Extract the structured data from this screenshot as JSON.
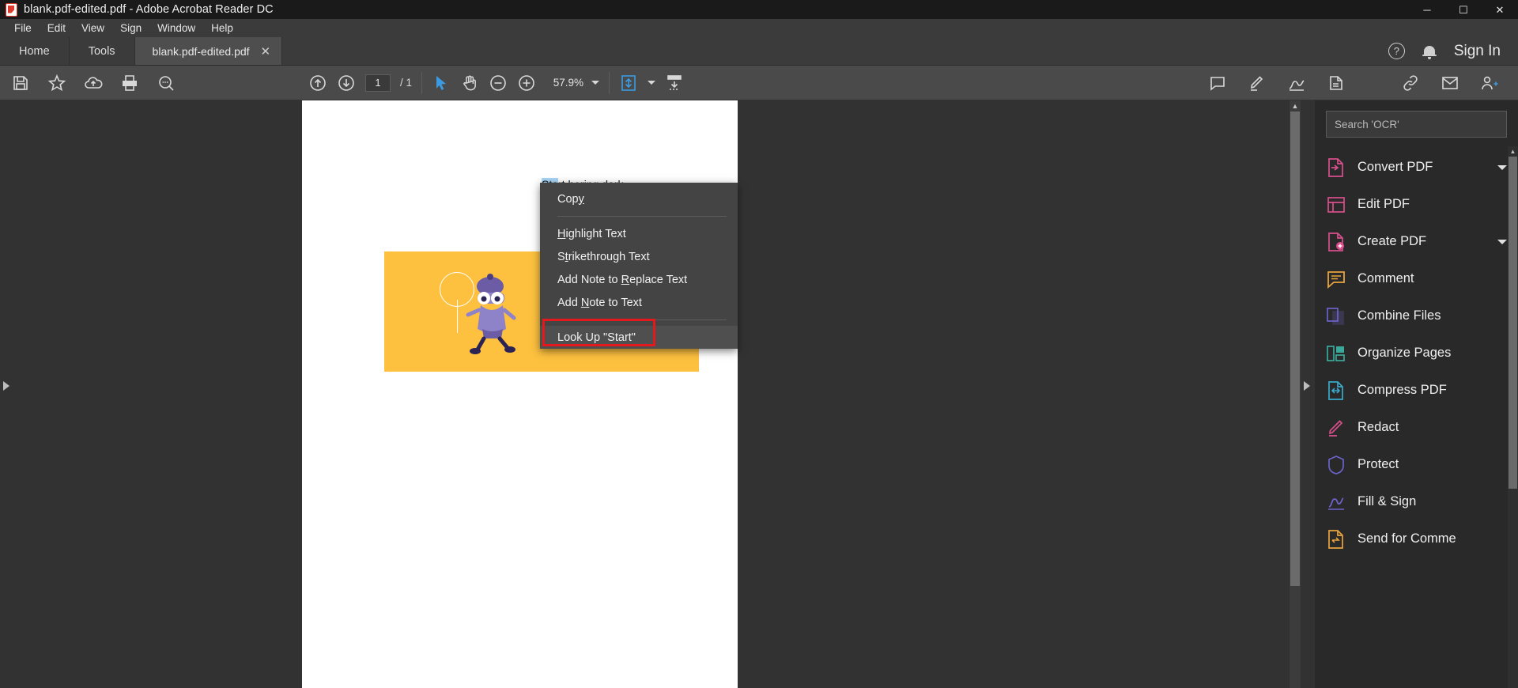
{
  "window": {
    "title": "blank.pdf-edited.pdf - Adobe Acrobat Reader DC",
    "app_icon": "acrobat-icon",
    "minimize": "─",
    "maximize": "☐",
    "close": "✕"
  },
  "menubar": {
    "items": [
      {
        "label": "File"
      },
      {
        "label": "Edit"
      },
      {
        "label": "View"
      },
      {
        "label": "Sign"
      },
      {
        "label": "Window"
      },
      {
        "label": "Help"
      }
    ]
  },
  "tabstrip": {
    "home": "Home",
    "tools": "Tools",
    "document_tab": "blank.pdf-edited.pdf",
    "document_tab_close": "✕",
    "help_icon": "?",
    "bell_icon": "notification-bell-icon",
    "sign_in": "Sign In"
  },
  "toolbar": {
    "left_icons": [
      {
        "name": "save-icon"
      },
      {
        "name": "star-icon"
      },
      {
        "name": "upload-cloud-icon"
      },
      {
        "name": "print-icon"
      },
      {
        "name": "find-icon"
      }
    ],
    "page_up_icon": "page-up-icon",
    "page_down_icon": "page-down-icon",
    "page_number": "1",
    "page_total": "/ 1",
    "select_tool_icon": "select-cursor-icon",
    "hand_tool_icon": "hand-tool-icon",
    "zoom_out_icon": "zoom-out-icon",
    "zoom_in_icon": "zoom-in-icon",
    "zoom_value": "57.9%",
    "fit_page_icon": "fit-page-icon",
    "scroll_mode_icon": "page-display-icon",
    "right_icons": [
      {
        "name": "comment-icon"
      },
      {
        "name": "highlighter-icon"
      },
      {
        "name": "draw-icon"
      },
      {
        "name": "stamp-icon"
      }
    ],
    "far_right_icons": [
      {
        "name": "attach-link-icon"
      },
      {
        "name": "email-icon"
      },
      {
        "name": "add-person-icon"
      }
    ]
  },
  "viewer": {
    "page_text_selected": "Sta",
    "page_text_rest": "rt hering dark",
    "scroll_up_arrow": "▲",
    "scroll_down_arrow": "▼",
    "left_rail_arrow": "left-panel-expand-arrow",
    "right_rail_arrow": "right-panel-expand-arrow",
    "image_alt": "yellow-illustration-card"
  },
  "context_menu": {
    "items": [
      {
        "label": "Copy",
        "accel": "y",
        "highlighted": false
      },
      {
        "separator": true
      },
      {
        "label": "Highlight Text",
        "accel": "H",
        "highlighted": false
      },
      {
        "label": "Strikethrough Text",
        "accel": "t",
        "highlighted": false
      },
      {
        "label": "Add Note to Replace Text",
        "accel": "R",
        "highlighted": false
      },
      {
        "label": "Add Note to Text",
        "accel": "N",
        "highlighted": false
      },
      {
        "separator": true
      },
      {
        "label": "Look Up \"Start\"",
        "accel": "",
        "highlighted": true
      }
    ],
    "highlight_color": "#e3191e"
  },
  "tools_panel": {
    "search_placeholder": "Search 'OCR'",
    "items": [
      {
        "label": "Convert PDF",
        "icon": "convert-pdf-icon",
        "chevron": true
      },
      {
        "label": "Edit PDF",
        "icon": "edit-pdf-icon",
        "chevron": false
      },
      {
        "label": "Create PDF",
        "icon": "create-pdf-icon",
        "chevron": true
      },
      {
        "label": "Comment",
        "icon": "comment-icon",
        "chevron": false
      },
      {
        "label": "Combine Files",
        "icon": "combine-files-icon",
        "chevron": false
      },
      {
        "label": "Organize Pages",
        "icon": "organize-pages-icon",
        "chevron": false
      },
      {
        "label": "Compress PDF",
        "icon": "compress-pdf-icon",
        "chevron": false
      },
      {
        "label": "Redact",
        "icon": "redact-icon",
        "chevron": false
      },
      {
        "label": "Protect",
        "icon": "protect-shield-icon",
        "chevron": false
      },
      {
        "label": "Fill & Sign",
        "icon": "fill-sign-icon",
        "chevron": false
      },
      {
        "label": "Send for Comme",
        "icon": "send-for-comments-icon",
        "chevron": false
      }
    ],
    "scroll_up_arrow": "▲",
    "scroll_down_arrow": "▼"
  },
  "colors": {
    "titlebar": "#1a1a1a",
    "chrome": "#3b3b3b",
    "toolbar": "#4a4a4a",
    "viewer_bg": "#323232",
    "panel_bg": "#292929",
    "card_yellow": "#fdc13f",
    "selection_blue": "#a8d4f5",
    "accent_red": "#e3191e"
  }
}
